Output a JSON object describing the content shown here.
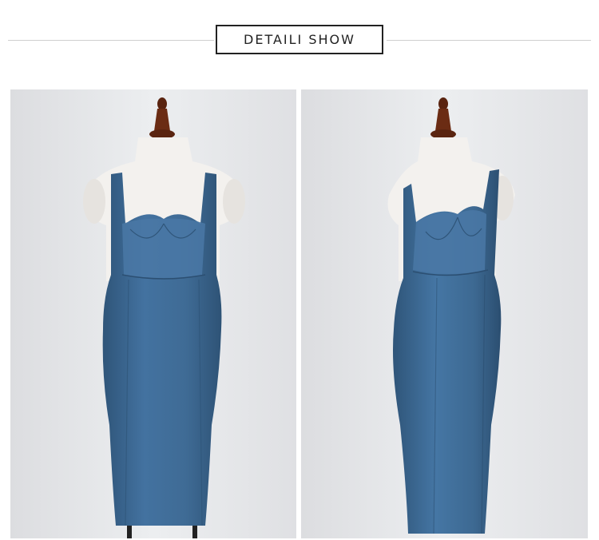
{
  "header": {
    "title": "DETAILI SHOW"
  },
  "photos": [
    {
      "name": "dress-front-view",
      "background": "#e7e8ea",
      "dress_color": "#3f6b95"
    },
    {
      "name": "dress-angled-view",
      "background": "#e7e8ea",
      "dress_color": "#3f6b95"
    }
  ],
  "colors": {
    "stand_wood": "#6b2c14",
    "form_white": "#f3f1ee",
    "dress_blue": "#3f6b95",
    "dress_shadow": "#2f5579"
  }
}
